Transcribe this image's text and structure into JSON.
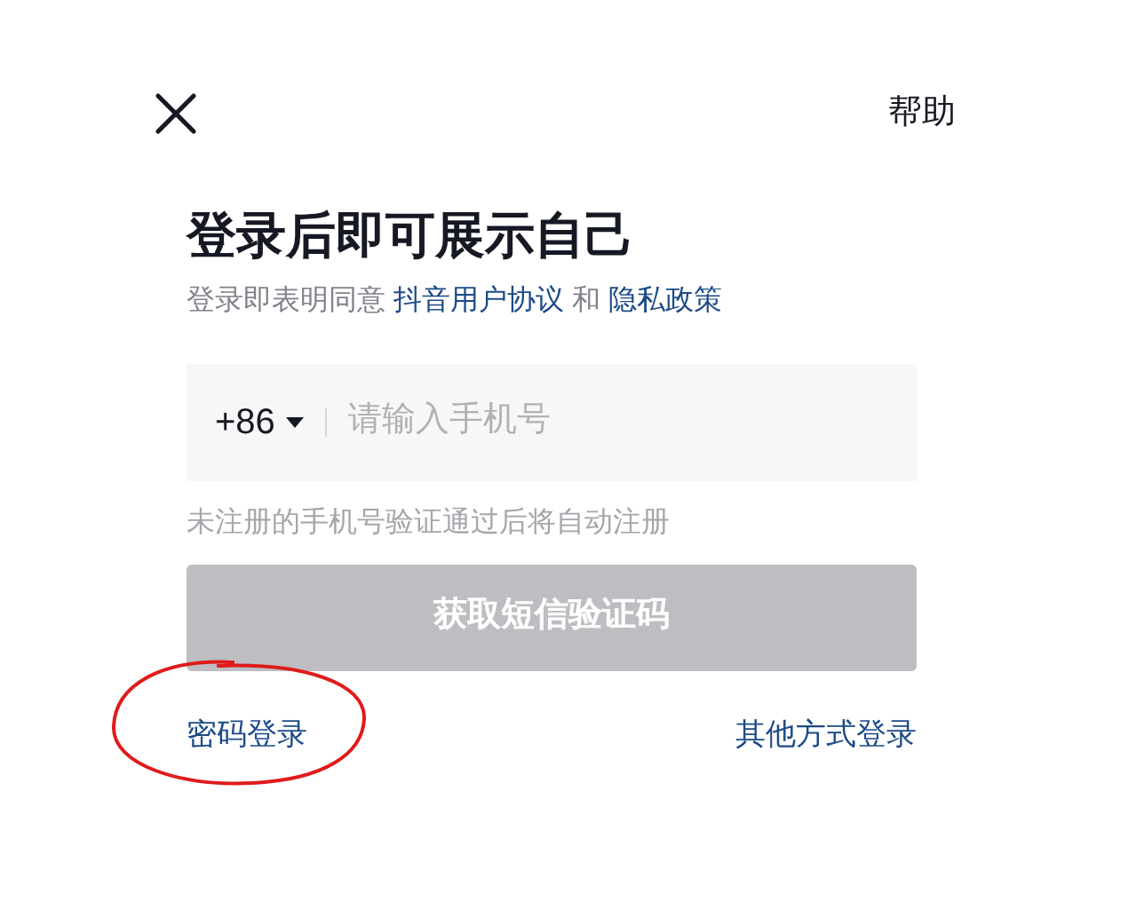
{
  "header": {
    "help": "帮助"
  },
  "title": "登录后即可展示自己",
  "agreement": {
    "prefix": "登录即表明同意",
    "link_1": "抖音用户协议",
    "conjunction": "和",
    "link_2": "隐私政策"
  },
  "phone_field": {
    "country_code": "+86",
    "placeholder": "请输入手机号"
  },
  "hint": "未注册的手机号验证通过后将自动注册",
  "submit_button": {
    "label": "获取短信验证码",
    "disabled": true
  },
  "links": [
    {
      "label": "密码登录",
      "annotated": true
    },
    {
      "label": "其他方式登录",
      "annotated": false
    }
  ]
}
